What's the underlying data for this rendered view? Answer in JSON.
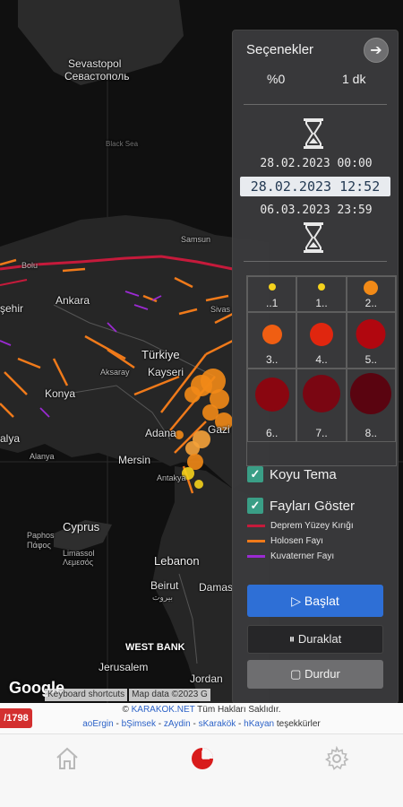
{
  "map": {
    "labels": {
      "sevastopol": "Sevastopol",
      "sevastopol_cyr": "Севастополь",
      "black_sea": "Black Sea",
      "samsun": "Samsun",
      "bolu": "Bolu",
      "ankara": "Ankara",
      "sivas": "Sivas",
      "sehir": "şehir",
      "turkiye": "Türkiye",
      "kayseri": "Kayseri",
      "aksaray": "Aksaray",
      "konya": "Konya",
      "adana": "Adana",
      "gazi": "Gazi",
      "alya": "alya",
      "mersin": "Mersin",
      "alanya": "Alanya",
      "antakya": "Antakya",
      "cyprus": "Cyprus",
      "paphos": "Paphos",
      "paphos_gr": "Πάφος",
      "limassol": "Limassol",
      "limassol_gr": "Λεμεσός",
      "lebanon": "Lebanon",
      "beirut": "Beirut",
      "beirut_ar": "بيروت",
      "damas": "Damas",
      "west_bank": "WEST BANK",
      "jerusalem": "Jerusalem",
      "jordan": "Jordan"
    },
    "google": "Google",
    "attrib": {
      "shortcuts": "Keyboard shortcuts",
      "data": "Map data ©2023 G"
    }
  },
  "panel": {
    "title": "Seçenekler",
    "arrow_icon": "arrow-right-icon",
    "percent": "%0",
    "duration": "1 dk",
    "date_start": "28.02.2023 00:00",
    "date_current": "28.02.2023 12:52",
    "date_end": "06.03.2023 23:59",
    "magnitudes": [
      {
        "label": "..1",
        "color": "#f5d21c"
      },
      {
        "label": "1..",
        "color": "#f5d21c"
      },
      {
        "label": "2..",
        "color": "#f28a17"
      },
      {
        "label": "3..",
        "color": "#f05e12"
      },
      {
        "label": "4..",
        "color": "#e0260f"
      },
      {
        "label": "5..",
        "color": "#b1070f"
      },
      {
        "label": "6..",
        "color": "#8a0610"
      },
      {
        "label": "7..",
        "color": "#7a0612"
      },
      {
        "label": "8..",
        "color": "#5a0410"
      }
    ],
    "dark_theme_label": "Koyu Tema",
    "dark_theme_checked": true,
    "show_faults_label": "Fayları Göster",
    "show_faults_checked": true,
    "legend": [
      {
        "label": "Deprem Yüzey Kırığı",
        "color": "#c51a3b"
      },
      {
        "label": "Holosen Fayı",
        "color": "#f07a1a"
      },
      {
        "label": "Kuvaterner Fayı",
        "color": "#9b2ad2"
      }
    ],
    "start_label": "▷ Başlat",
    "pause_label": "⏸ Duraklat",
    "stop_label": "▢ Durdur"
  },
  "footer": {
    "copyright_prefix": "© ",
    "site": "KARAKOK.NET",
    "rights": " Tüm Hakları Saklıdır.",
    "thanks": [
      "aoErgin",
      "bŞimsek",
      "zAydin",
      "sKarakök",
      "hKayan"
    ],
    "thanks_suffix": " teşekkürler",
    "badge": "/1798"
  }
}
